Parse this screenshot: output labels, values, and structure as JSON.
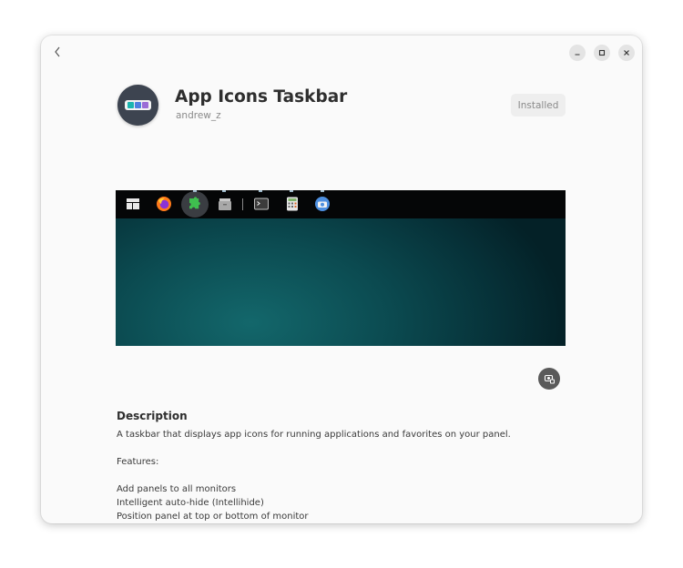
{
  "app": {
    "title": "App Icons Taskbar",
    "author": "andrew_z",
    "status": "Installed"
  },
  "window_controls": {
    "minimize_icon": "minimize-icon",
    "maximize_icon": "maximize-icon",
    "close_icon": "close-icon",
    "back_icon": "chevron-left-icon"
  },
  "screenshot": {
    "taskbar_icons": [
      "activities-icon",
      "firefox-icon",
      "extensions-icon",
      "files-icon",
      "terminal-icon",
      "calculator-icon",
      "screenshot-app-icon"
    ]
  },
  "description": {
    "heading": "Description",
    "summary": "A taskbar that displays app icons for running applications and favorites on your panel.",
    "features_label": "Features:",
    "features": [
      "Add panels to all monitors",
      "Intelligent auto-hide (Intellihide)",
      "Position panel at top or bottom of monitor"
    ]
  },
  "colors": {
    "window_bg": "#fafafa",
    "icon_bg": "#3d4450",
    "icon_teal": "#1bb5b0",
    "icon_blue": "#4e7fe0",
    "icon_purple": "#9b6cd6",
    "screenshot_teal": "#13676b"
  }
}
